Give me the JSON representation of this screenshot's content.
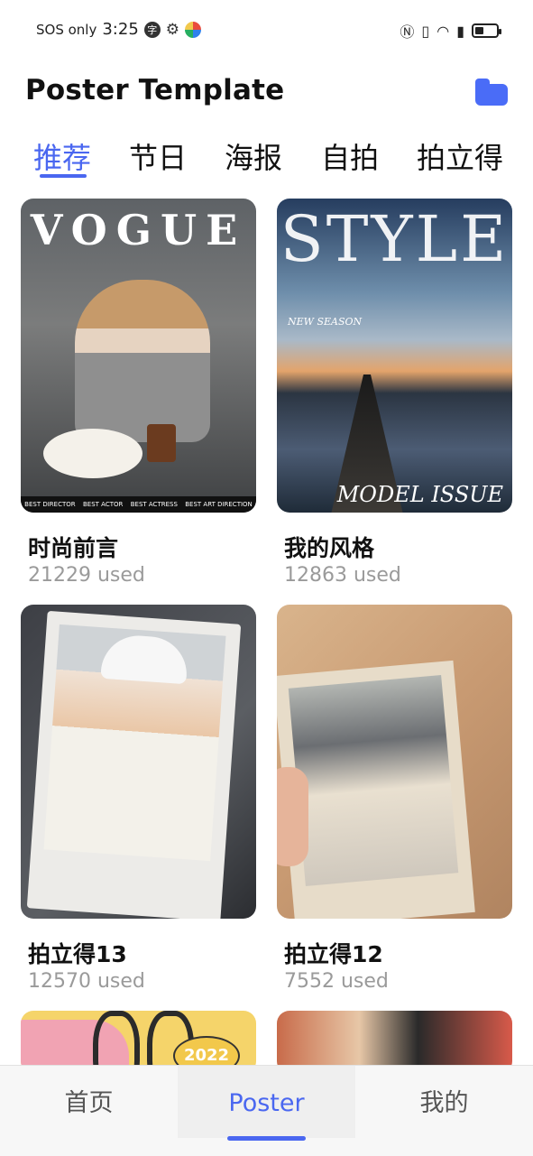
{
  "status": {
    "carrier": "SOS only",
    "time": "3:25",
    "badge": "字"
  },
  "header": {
    "title": "Poster Template"
  },
  "tabs": [
    {
      "label": "推荐",
      "active": true
    },
    {
      "label": "节日",
      "active": false
    },
    {
      "label": "海报",
      "active": false
    },
    {
      "label": "自拍",
      "active": false
    },
    {
      "label": "拍立得",
      "active": false
    }
  ],
  "cards": [
    {
      "title": "时尚前言",
      "used": "21229 used",
      "thumb_text": "VOGUE"
    },
    {
      "title": "我的风格",
      "used": "12863 used",
      "thumb_text": "STYLE",
      "thumb_text2": "NEW SEASON",
      "thumb_text3": "MODEL ISSUE"
    },
    {
      "title": "拍立得13",
      "used": "12570 used"
    },
    {
      "title": "拍立得12",
      "used": "7552 used"
    }
  ],
  "partial_cards": [
    {
      "thumb_text": "2022"
    },
    {}
  ],
  "bottom_nav": [
    {
      "label": "首页",
      "active": false
    },
    {
      "label": "Poster",
      "active": true
    },
    {
      "label": "我的",
      "active": false
    }
  ],
  "colors": {
    "accent": "#4a67f0"
  }
}
